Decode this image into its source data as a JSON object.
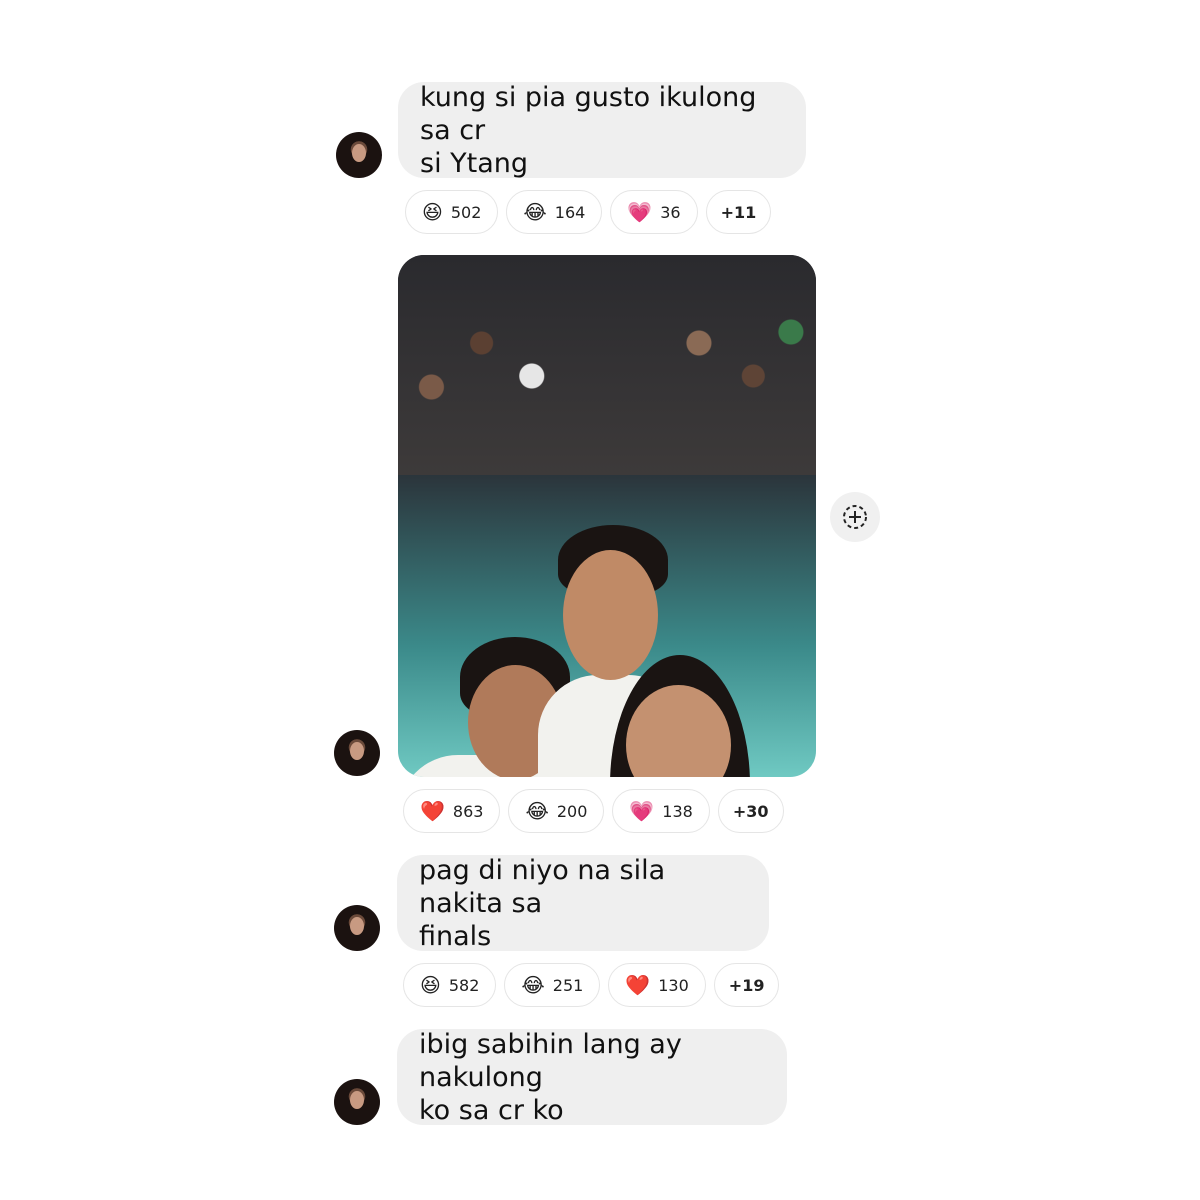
{
  "messages": [
    {
      "text": "kung si pia gusto ikulong sa cr\nsi Ytang",
      "reactions": [
        {
          "emoji": "😆",
          "count": "502"
        },
        {
          "emoji": "😂",
          "count": "164"
        },
        {
          "emoji": "💗",
          "count": "36"
        }
      ],
      "more": "+11"
    },
    {
      "image": "selfie-photo",
      "reactions": [
        {
          "emoji": "❤️",
          "count": "863"
        },
        {
          "emoji": "😂",
          "count": "200"
        },
        {
          "emoji": "💗",
          "count": "138"
        }
      ],
      "more": "+30"
    },
    {
      "text": "pag di niyo na sila nakita sa\nfinals",
      "reactions": [
        {
          "emoji": "😆",
          "count": "582"
        },
        {
          "emoji": "😂",
          "count": "251"
        },
        {
          "emoji": "❤️",
          "count": "130"
        }
      ],
      "more": "+19"
    },
    {
      "text": "ibig sabihin lang ay nakulong\nko sa cr ko"
    }
  ],
  "icons": {
    "add_reaction": "add-reaction-icon"
  }
}
